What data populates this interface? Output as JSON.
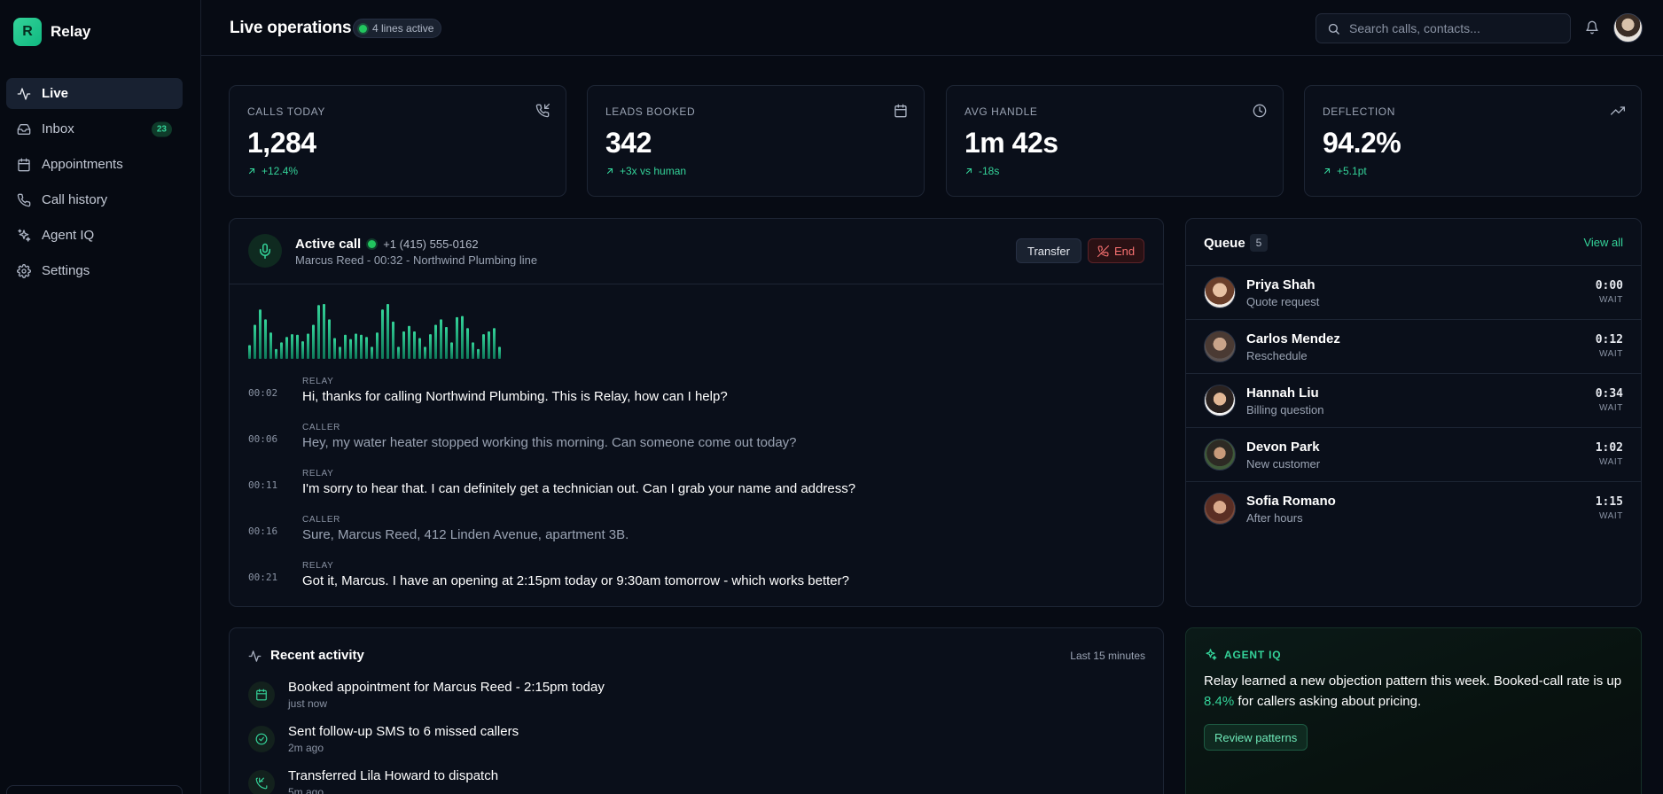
{
  "brand": {
    "logo_letter": "R",
    "name": "Relay",
    "accent": "#34d399"
  },
  "sidebar": {
    "items": [
      {
        "label": "Live",
        "icon": "activity-icon",
        "active": true
      },
      {
        "label": "Inbox",
        "icon": "inbox-icon",
        "badge": "23"
      },
      {
        "label": "Appointments",
        "icon": "calendar-icon"
      },
      {
        "label": "Call history",
        "icon": "phone-icon"
      },
      {
        "label": "Agent IQ",
        "icon": "sparkles-icon"
      },
      {
        "label": "Settings",
        "icon": "gear-icon"
      }
    ]
  },
  "header": {
    "title": "Live operations",
    "lines_status": "4 lines active",
    "search_placeholder": "Search calls, contacts..."
  },
  "stats": [
    {
      "label": "CALLS TODAY",
      "value": "1,284",
      "delta": "+12.4%",
      "icon": "phone-incoming-icon"
    },
    {
      "label": "LEADS BOOKED",
      "value": "342",
      "delta": "+3x vs human",
      "icon": "calendar-icon"
    },
    {
      "label": "AVG HANDLE",
      "value": "1m 42s",
      "delta": "-18s",
      "icon": "clock-icon"
    },
    {
      "label": "DEFLECTION",
      "value": "94.2%",
      "delta": "+5.1pt",
      "icon": "trending-up-icon"
    }
  ],
  "active_call": {
    "title": "Active call",
    "phone": "+1 (415) 555-0162",
    "subtitle": "Marcus Reed - 00:32 - Northwind Plumbing line",
    "transfer_label": "Transfer",
    "end_label": "End",
    "waveform_levels": [
      0.25,
      0.62,
      0.9,
      0.72,
      0.48,
      0.18,
      0.3,
      0.4,
      0.45,
      0.44,
      0.32,
      0.46,
      0.62,
      0.98,
      1.0,
      0.72,
      0.38,
      0.22,
      0.44,
      0.36,
      0.46,
      0.44,
      0.4,
      0.22,
      0.48,
      0.9,
      1.0,
      0.68,
      0.22,
      0.5,
      0.6,
      0.5,
      0.38,
      0.22,
      0.45,
      0.62,
      0.72,
      0.58,
      0.3,
      0.76,
      0.78,
      0.56,
      0.3,
      0.18,
      0.45,
      0.5,
      0.56,
      0.22
    ],
    "transcript": [
      {
        "time": "00:02",
        "speaker": "RELAY",
        "text": "Hi, thanks for calling Northwind Plumbing. This is Relay, how can I help?"
      },
      {
        "time": "00:06",
        "speaker": "CALLER",
        "text": "Hey, my water heater stopped working this morning. Can someone come out today?"
      },
      {
        "time": "00:11",
        "speaker": "RELAY",
        "text": "I'm sorry to hear that. I can definitely get a technician out. Can I grab your name and address?"
      },
      {
        "time": "00:16",
        "speaker": "CALLER",
        "text": "Sure, Marcus Reed, 412 Linden Avenue, apartment 3B."
      },
      {
        "time": "00:21",
        "speaker": "RELAY",
        "text": "Got it, Marcus. I have an opening at 2:15pm today or 9:30am tomorrow - which works better?"
      }
    ]
  },
  "queue": {
    "title": "Queue",
    "count": "5",
    "view_all": "View all",
    "items": [
      {
        "name": "Priya Shah",
        "reason": "Quote request",
        "time": "0:00",
        "status": "WAIT"
      },
      {
        "name": "Carlos Mendez",
        "reason": "Reschedule",
        "time": "0:12",
        "status": "WAIT"
      },
      {
        "name": "Hannah Liu",
        "reason": "Billing question",
        "time": "0:34",
        "status": "WAIT"
      },
      {
        "name": "Devon Park",
        "reason": "New customer",
        "time": "1:02",
        "status": "WAIT"
      },
      {
        "name": "Sofia Romano",
        "reason": "After hours",
        "time": "1:15",
        "status": "WAIT"
      }
    ]
  },
  "activity": {
    "title": "Recent activity",
    "range": "Last 15 minutes",
    "items": [
      {
        "text": "Booked appointment for Marcus Reed - 2:15pm today",
        "time": "just now",
        "icon": "calendar-icon"
      },
      {
        "text": "Sent follow-up SMS to 6 missed callers",
        "time": "2m ago",
        "icon": "check-circle-icon"
      },
      {
        "text": "Transferred Lila Howard to dispatch",
        "time": "5m ago",
        "icon": "phone-forward-icon"
      }
    ]
  },
  "agent_iq": {
    "label": "AGENT IQ",
    "text_before": "Relay learned a new objection pattern this week. Booked-call rate is up",
    "highlight": "8.4%",
    "text_after": "for callers asking about pricing.",
    "button_label": "Review patterns"
  }
}
